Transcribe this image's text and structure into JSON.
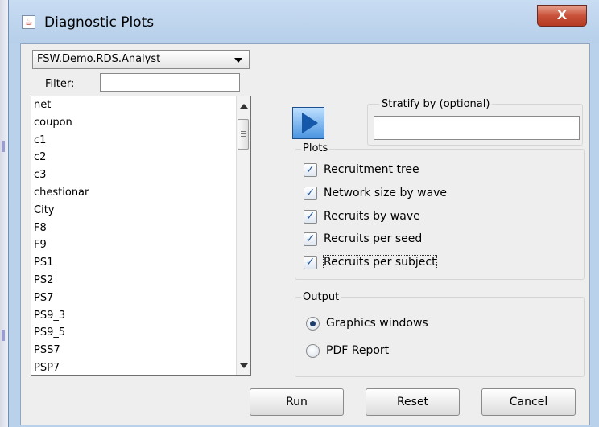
{
  "window": {
    "title": "Diagnostic Plots",
    "close_glyph": "X",
    "icon": "java-cup-icon"
  },
  "dataset": {
    "selected": "FSW.Demo.RDS.Analyst"
  },
  "filter": {
    "label": "Filter:",
    "value": ""
  },
  "variables": {
    "items": [
      "net",
      "coupon",
      "c1",
      "c2",
      "c3",
      "chestionar",
      "City",
      "F8",
      "F9",
      "PS1",
      "PS2",
      "PS7",
      "PS9_3",
      "PS9_5",
      "PSS7",
      "PSP7"
    ]
  },
  "stratify": {
    "label": "Stratify by (optional)",
    "value": ""
  },
  "plots": {
    "label": "Plots",
    "options": [
      {
        "label": "Recruitment tree",
        "checked": true
      },
      {
        "label": "Network size by wave",
        "checked": true
      },
      {
        "label": "Recruits by wave",
        "checked": true
      },
      {
        "label": "Recruits per seed",
        "checked": true
      },
      {
        "label": "Recruits per subject",
        "checked": true
      }
    ]
  },
  "output": {
    "label": "Output",
    "options": [
      {
        "label": "Graphics windows",
        "selected": true
      },
      {
        "label": "PDF Report",
        "selected": false
      }
    ]
  },
  "buttons": {
    "run": "Run",
    "reset": "Reset",
    "cancel": "Cancel"
  },
  "colors": {
    "title_bar": "#b9d1ea",
    "close_button": "#c9523a",
    "panel": "#eeeeee",
    "accent": "#1557a8"
  }
}
